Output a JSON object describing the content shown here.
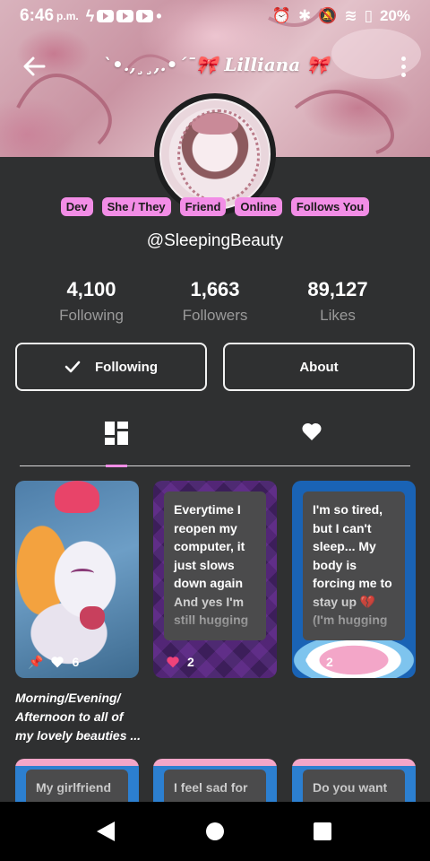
{
  "status_bar": {
    "time": "6:46",
    "ampm": "p.m.",
    "battery": "20%"
  },
  "appbar": {
    "title": "`•.,¸¸,.•´¯🎀 𝑳𝒊𝒍𝒍𝒊𝒂𝒏𝒂 🎀",
    "back_icon": "arrow-left-icon",
    "menu_icon": "more-vert-icon"
  },
  "profile": {
    "badges": [
      "Dev",
      "She / They",
      "Friend",
      "Online",
      "Follows You"
    ],
    "badge_color": "#f28de6",
    "username": "@SleepingBeauty",
    "stats": [
      {
        "value": "4,100",
        "label": "Following"
      },
      {
        "value": "1,663",
        "label": "Followers"
      },
      {
        "value": "89,127",
        "label": "Likes"
      }
    ],
    "following_button": "Following",
    "about_button": "About"
  },
  "tabs": {
    "posts_icon": "dashboard-icon",
    "likes_icon": "heart-icon",
    "active": "posts",
    "indicator_color": "#f28de6"
  },
  "posts": [
    {
      "type": "image",
      "likes": "6",
      "pinned": true,
      "caption": "Morning/Evening/ Afternoon to all of my lovely beauties ..."
    },
    {
      "type": "text",
      "text": "Everytime I reopen my computer, it just slows down again And yes I'm still hugging",
      "likes": "2",
      "liked": true
    },
    {
      "type": "text",
      "text": "I'm so tired, but I can't sleep... My body is forcing me to stay up 💔 (I'm hugging",
      "likes": "2",
      "liked": false
    },
    {
      "type": "text",
      "text": "My girlfriend"
    },
    {
      "type": "text",
      "text": "I feel sad for"
    },
    {
      "type": "text",
      "text": "Do you want"
    }
  ]
}
